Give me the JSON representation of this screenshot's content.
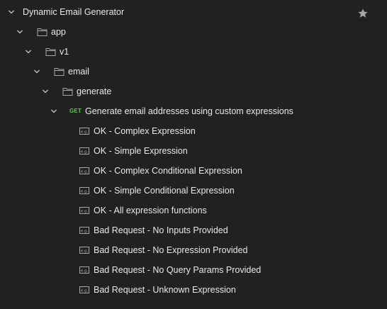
{
  "collection": {
    "name": "Dynamic Email Generator",
    "star_icon": "star-icon"
  },
  "folders": [
    {
      "name": "app"
    },
    {
      "name": "v1"
    },
    {
      "name": "email"
    },
    {
      "name": "generate"
    }
  ],
  "request": {
    "method": "GET",
    "name": "Generate email addresses using custom expressions"
  },
  "examples": [
    {
      "name": "OK - Complex Expression"
    },
    {
      "name": "OK - Simple Expression"
    },
    {
      "name": "OK - Complex Conditional Expression"
    },
    {
      "name": "OK - Simple Conditional Expression"
    },
    {
      "name": "OK - All expression functions"
    },
    {
      "name": "Bad Request - No Inputs Provided"
    },
    {
      "name": "Bad Request - No Expression Provided"
    },
    {
      "name": "Bad Request - No Query Params Provided"
    },
    {
      "name": "Bad Request - Unknown Expression"
    }
  ],
  "colors": {
    "background": "#212121",
    "text": "#e8e8e8",
    "icon": "#a6a6a6",
    "get_method": "#6bbf59"
  }
}
